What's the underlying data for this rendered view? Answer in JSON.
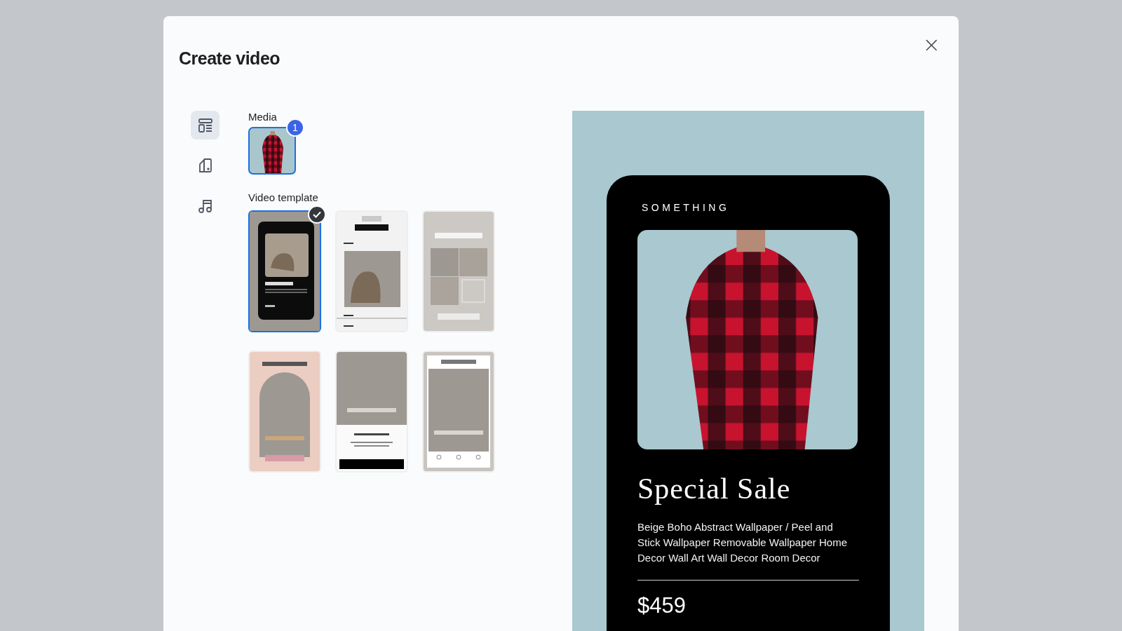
{
  "dialog": {
    "title": "Create video",
    "close": "×"
  },
  "nav": [
    {
      "kind": "layout",
      "selected": true
    },
    {
      "kind": "shapes",
      "selected": false
    },
    {
      "kind": "music",
      "selected": false
    }
  ],
  "media": {
    "label": "Media",
    "count": "1",
    "items": [
      {
        "selected": true
      }
    ]
  },
  "video_template": {
    "label": "Video template",
    "items": [
      {
        "kind": "dark-card",
        "selected": true
      },
      {
        "kind": "product-list",
        "selected": false
      },
      {
        "kind": "collection-grid",
        "selected": false
      },
      {
        "kind": "arch",
        "selected": false
      },
      {
        "kind": "banner",
        "selected": false
      },
      {
        "kind": "framed",
        "selected": false
      }
    ]
  },
  "preview": {
    "brand": "SOMETHING",
    "title": "Special Sale",
    "description": "Beige Boho Abstract Wallpaper / Peel and Stick Wallpaper Removable Wallpaper Home Decor Wall Art Wall Decor Room Decor",
    "price": "$459"
  }
}
